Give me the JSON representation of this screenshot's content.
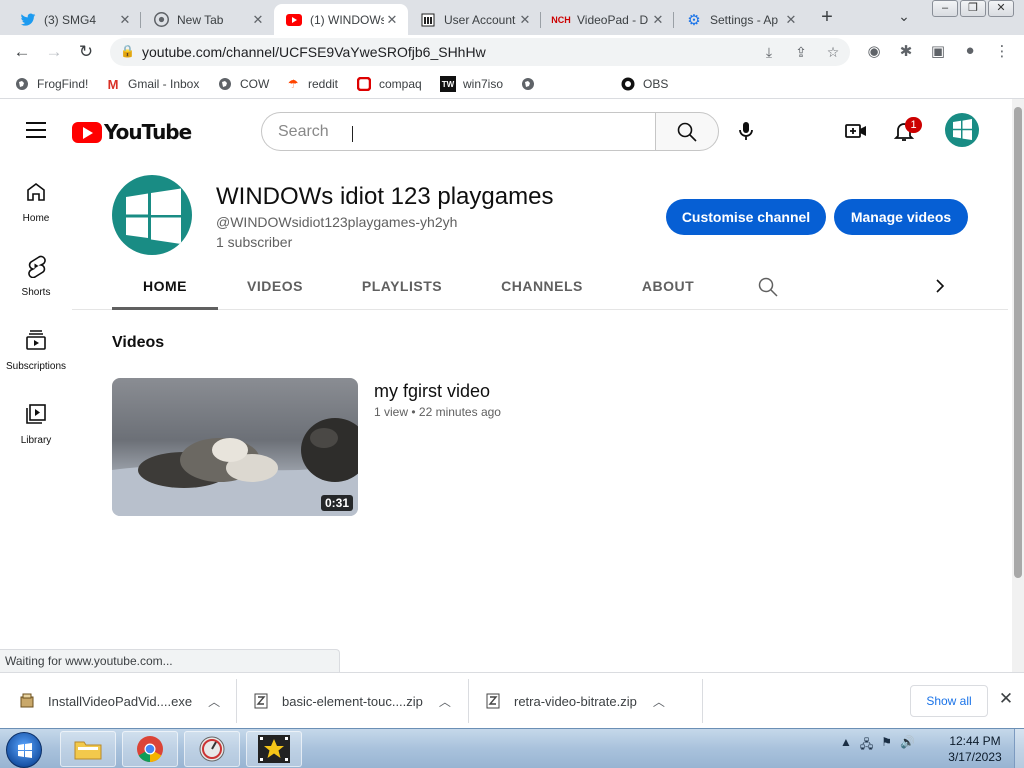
{
  "browser": {
    "tabs": [
      {
        "title": "(3) SMG4",
        "favicon": "twitter-icon"
      },
      {
        "title": "New Tab",
        "favicon": "chrome-icon"
      },
      {
        "title": "(1) WINDOWs",
        "favicon": "youtube-icon"
      },
      {
        "title": "User Account",
        "favicon": "bank-icon"
      },
      {
        "title": "VideoPad - D",
        "favicon": "nch-icon"
      },
      {
        "title": "Settings - Ap",
        "favicon": "gear-icon"
      }
    ],
    "url": "youtube.com/channel/UCFSE9VaYweSROfjb6_SHhHw",
    "bookmarks": [
      {
        "label": "FrogFind!",
        "icon": "globe-icon"
      },
      {
        "label": "Gmail - Inbox",
        "icon": "gmail-icon"
      },
      {
        "label": "COW",
        "icon": "globe-icon"
      },
      {
        "label": "reddit",
        "icon": "reddit-icon"
      },
      {
        "label": "compaq",
        "icon": "compaq-icon"
      },
      {
        "label": "win7iso",
        "icon": "tw-icon"
      },
      {
        "label": "",
        "icon": "globe-icon"
      },
      {
        "label": "OBS",
        "icon": "github-icon"
      }
    ],
    "status": "Waiting for www.youtube.com...",
    "downloads": [
      {
        "name": "InstallVideoPadVid....exe"
      },
      {
        "name": "basic-element-touc....zip"
      },
      {
        "name": "retra-video-bitrate.zip"
      }
    ],
    "show_all": "Show all"
  },
  "youtube": {
    "logo_text": "YouTube",
    "search_placeholder": "Search",
    "notification_count": "1",
    "guide": [
      {
        "label": "Home",
        "icon": "home-icon"
      },
      {
        "label": "Shorts",
        "icon": "shorts-icon"
      },
      {
        "label": "Subscriptions",
        "icon": "subscriptions-icon"
      },
      {
        "label": "Library",
        "icon": "library-icon"
      }
    ],
    "channel": {
      "title": "WINDOWs idiot 123 playgames",
      "handle": "@WINDOWsidiot123playgames-yh2yh",
      "subscribers": "1 subscriber",
      "customise_label": "Customise channel",
      "manage_label": "Manage videos",
      "tabs": [
        "HOME",
        "VIDEOS",
        "PLAYLISTS",
        "CHANNELS",
        "ABOUT"
      ],
      "selected_tab": "HOME"
    },
    "section_title": "Videos",
    "video": {
      "title": "my fgirst video",
      "views": "1 view",
      "age": "22 minutes ago",
      "duration": "0:31"
    }
  },
  "taskbar": {
    "time": "12:44 PM",
    "date": "3/17/2023"
  },
  "colors": {
    "brand_red": "#ff0000",
    "button_blue": "#065fd4",
    "avatar_teal": "#198c84"
  }
}
